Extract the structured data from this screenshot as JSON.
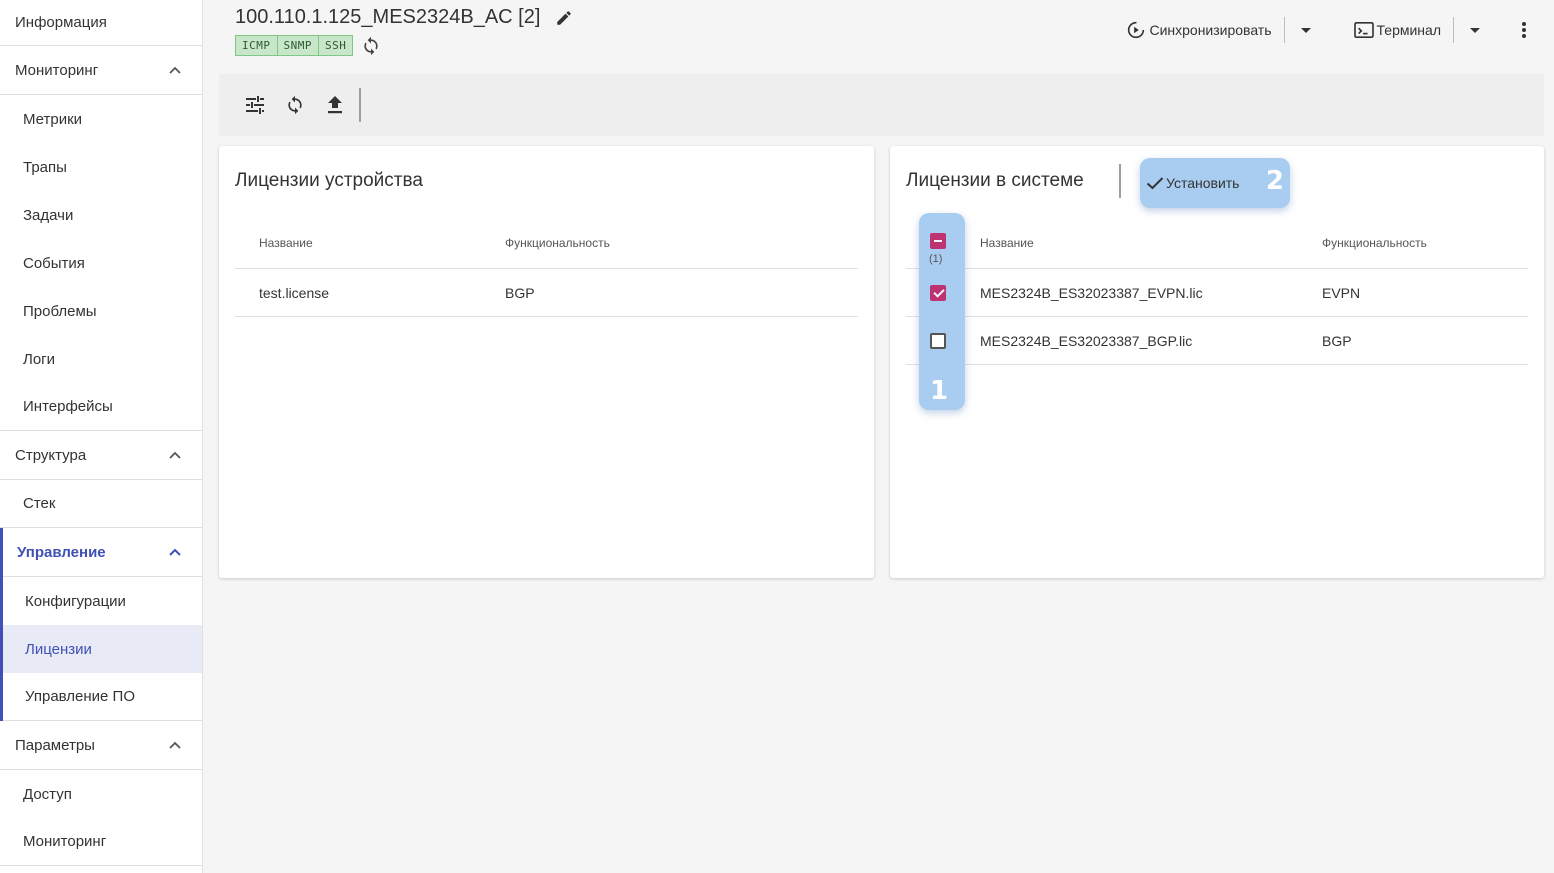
{
  "sidebar": {
    "top_item": "Информация",
    "groups": [
      {
        "label": "Мониторинг",
        "items": [
          "Метрики",
          "Трапы",
          "Задачи",
          "События",
          "Проблемы",
          "Логи",
          "Интерфейсы"
        ]
      },
      {
        "label": "Структура",
        "items": [
          "Стек"
        ]
      },
      {
        "label": "Управление",
        "items": [
          "Конфигурации",
          "Лицензии",
          "Управление ПО"
        ],
        "active": true,
        "selected_item": "Лицензии"
      },
      {
        "label": "Параметры",
        "items": [
          "Доступ",
          "Мониторинг"
        ]
      }
    ],
    "accent_color": "#3f51b5"
  },
  "header": {
    "title": "100.110.1.125_MES2324B_AC [2]",
    "badges": [
      "ICMP",
      "SNMP",
      "SSH"
    ],
    "sync_label": "Синхронизировать",
    "terminal_label": "Терминал"
  },
  "toolbar": {
    "icons": [
      "tune-icon",
      "sync-icon",
      "upload-icon"
    ]
  },
  "device_licenses": {
    "title": "Лицензии устройства",
    "columns": [
      "Название",
      "Функциональность"
    ],
    "rows": [
      {
        "name": "test.license",
        "feature": "BGP"
      }
    ]
  },
  "system_licenses": {
    "title": "Лицензии в системе",
    "install_label": "Установить",
    "install_step": "2",
    "select_step": "1",
    "selected_count": "(1)",
    "columns": [
      "Название",
      "Функциональность"
    ],
    "rows": [
      {
        "name": "MES2324B_ES32023387_EVPN.lic",
        "feature": "EVPN",
        "checked": true
      },
      {
        "name": "MES2324B_ES32023387_BGP.lic",
        "feature": "BGP",
        "checked": false
      }
    ]
  }
}
